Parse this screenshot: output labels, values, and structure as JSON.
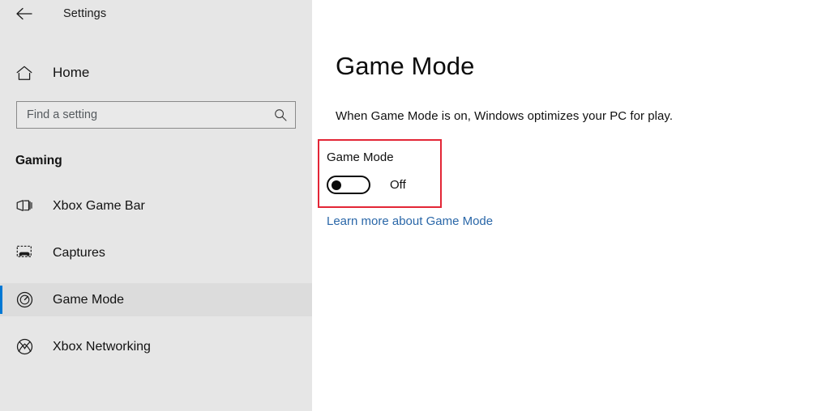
{
  "window": {
    "back_icon": "back-arrow-icon",
    "app_title": "Settings"
  },
  "sidebar": {
    "home": {
      "icon": "home-icon",
      "label": "Home"
    },
    "search": {
      "placeholder": "Find a setting",
      "value": "",
      "icon": "search-icon"
    },
    "section_header": "Gaming",
    "items": [
      {
        "label": "Xbox Game Bar",
        "icon": "game-bar-icon",
        "selected": false
      },
      {
        "label": "Captures",
        "icon": "captures-icon",
        "selected": false
      },
      {
        "label": "Game Mode",
        "icon": "gauge-icon",
        "selected": true
      },
      {
        "label": "Xbox Networking",
        "icon": "xbox-logo-icon",
        "selected": false
      }
    ],
    "accent_color": "#0078d4",
    "background_color": "#e6e6e6",
    "selected_background_color": "#dcdcdc"
  },
  "main": {
    "page_title": "Game Mode",
    "description": "When Game Mode is on, Windows optimizes your PC for play.",
    "setting": {
      "label": "Game Mode",
      "toggle_state": "Off",
      "toggle_on": false
    },
    "link": "Learn more about Game Mode",
    "link_color": "#2a67a8",
    "highlight_color": "#e32636"
  }
}
